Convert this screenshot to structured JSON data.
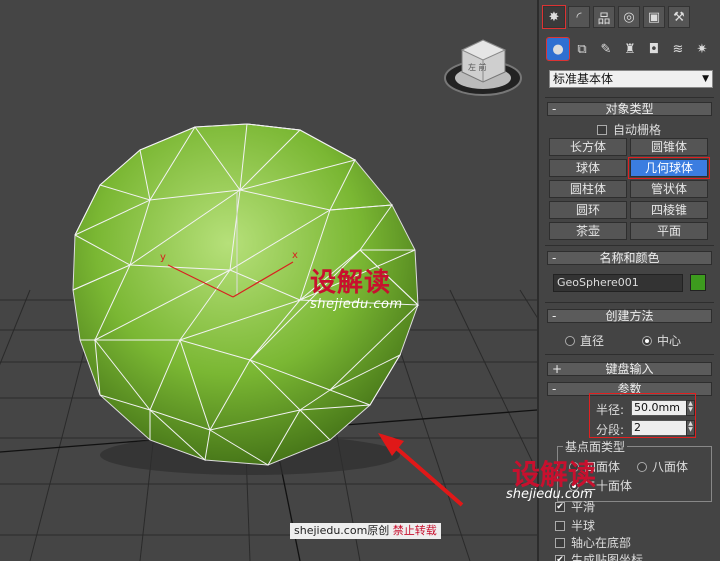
{
  "viewport": {
    "axis_x_label": "x",
    "axis_y_label": "y",
    "watermark": {
      "brand": "设解读",
      "url": "shejiedu.com"
    },
    "footer": {
      "site": "shejiedu.com",
      "original": "原创",
      "no_repost": "禁止转载"
    },
    "viewcube_label": "左 前"
  },
  "panel": {
    "tabs": [
      "create-icon",
      "modify-icon",
      "hierarchy-icon",
      "motion-icon",
      "display-icon",
      "utilities-icon"
    ],
    "subtabs": [
      "geometry-icon",
      "shapes-icon",
      "lights-icon",
      "cameras-icon",
      "helpers-icon",
      "spacewarps-icon",
      "systems-icon"
    ],
    "category_dropdown": "标准基本体",
    "object_type": {
      "header": "对象类型",
      "autogrid_label": "自动栅格",
      "buttons": [
        "长方体",
        "圆锥体",
        "球体",
        "几何球体",
        "圆柱体",
        "管状体",
        "圆环",
        "四棱锥",
        "茶壶",
        "平面"
      ],
      "active_button": "几何球体"
    },
    "name_color": {
      "header": "名称和颜色",
      "name_value": "GeoSphere001",
      "color": "#3d9b1e"
    },
    "creation_method": {
      "header": "创建方法",
      "option_edge": "直径",
      "option_center": "中心",
      "selected": "中心"
    },
    "keyboard_entry": {
      "header": "键盘输入",
      "sign": "+"
    },
    "parameters": {
      "header": "参数",
      "radius_label": "半径:",
      "radius_value": "50.0mm",
      "segments_label": "分段:",
      "segments_value": "2",
      "base_type_label": "基点面类型",
      "tetra_label": "四面体",
      "octa_label": "八面体",
      "icosa_label": "二十面体",
      "smooth_label": "平滑",
      "hemisphere_label": "半球",
      "base_pivot_label": "轴心在底部",
      "gen_mapping_label": "生成贴图坐标"
    }
  }
}
